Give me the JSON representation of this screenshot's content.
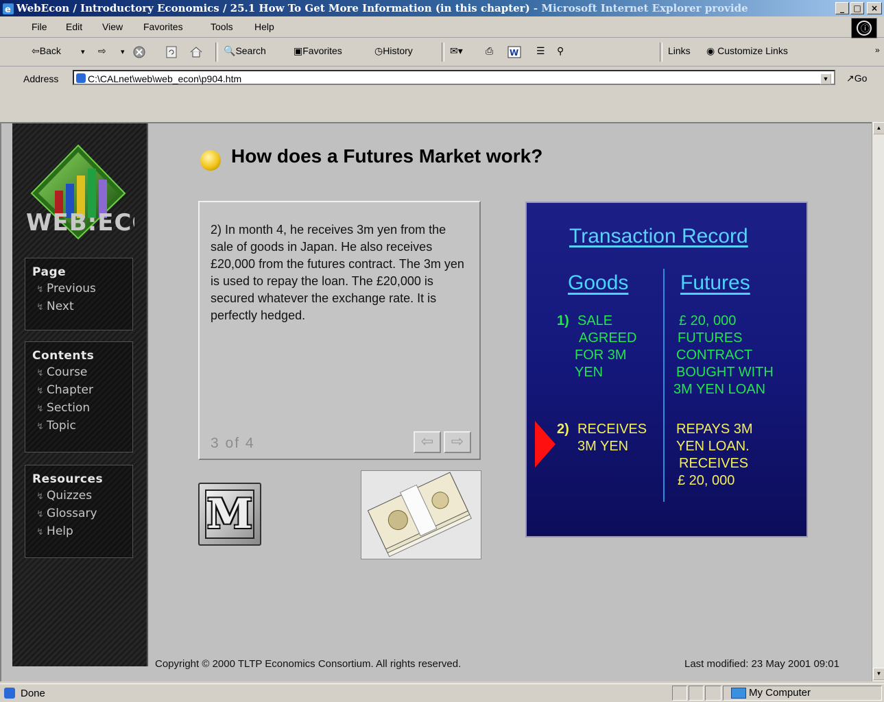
{
  "window": {
    "title": "WebEcon / Introductory Economics / 25.1 How To Get More Information (in this chapter)",
    "title_suffix": "- Microsoft Internet Explorer provide",
    "minimize": "_",
    "maximize": "□",
    "close": "×"
  },
  "menu": {
    "items": [
      "File",
      "Edit",
      "View",
      "Favorites",
      "Tools",
      "Help"
    ]
  },
  "toolbar": {
    "back": "⇦Back",
    "forward": "⇨",
    "search": "Search",
    "favorites": "Favorites",
    "history": "History",
    "links": "Links",
    "customize_links": "Customize Links",
    "more": "»"
  },
  "address": {
    "label": "Address",
    "value": "C:\\CALnet\\web\\web_econ\\p904.htm",
    "go": "Go"
  },
  "sidebar": {
    "logo_text": "WEB:ECON",
    "sections": [
      {
        "heading": "Page",
        "items": [
          "Previous",
          "Next"
        ]
      },
      {
        "heading": "Contents",
        "items": [
          "Course",
          "Chapter",
          "Section",
          "Topic"
        ]
      },
      {
        "heading": "Resources",
        "items": [
          "Quizzes",
          "Glossary",
          "Help"
        ]
      }
    ]
  },
  "page": {
    "heading": "How does a Futures Market work?",
    "body": "2)  In month 4, he receives 3m yen from the sale of goods in Japan. He also receives £20,000 from the futures contract. The 3m yen is used to repay the loan. The £20,000 is secured whatever the exchange rate. It is perfectly hedged.",
    "pager": "3  of  4",
    "m_button": "M"
  },
  "slide": {
    "title": "Transaction Record",
    "col_goods": "Goods",
    "col_futures": "Futures",
    "row1_num": "1)",
    "row1_goods": [
      "SALE",
      "AGREED",
      "FOR 3M",
      "YEN"
    ],
    "row1_futures": [
      "£ 20, 000",
      "FUTURES",
      "CONTRACT",
      "BOUGHT WITH",
      "3M YEN  LOAN"
    ],
    "row2_num": "2)",
    "row2_goods": [
      "RECEIVES",
      "3M YEN"
    ],
    "row2_futures": [
      "REPAYS 3M",
      "YEN  LOAN.",
      "RECEIVES",
      "£ 20, 000"
    ],
    "colors": {
      "row1": "#23e54c",
      "row2": "#f5ef5a",
      "heading": "#4bd4ff",
      "pointer": "#ff1010"
    }
  },
  "footer": {
    "copyright": "Copyright © 2000 TLTP Economics Consortium. All rights reserved.",
    "last_modified": "Last modified: 23 May 2001 09:01"
  },
  "status": {
    "text": "Done",
    "zone": "My Computer"
  }
}
